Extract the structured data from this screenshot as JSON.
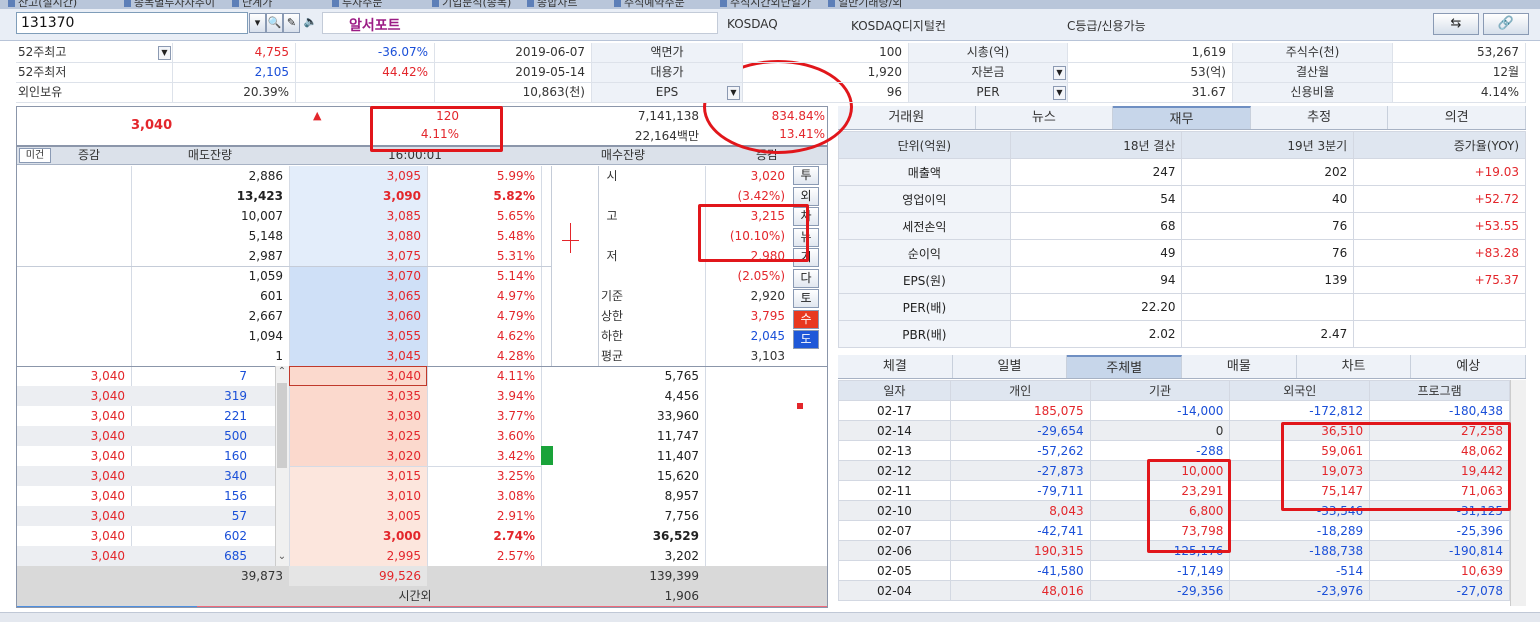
{
  "top_tabs": [
    "잔고(실시간)",
    "종목별투자자추이",
    "단계가",
    "투자주문",
    "기업분석(종목)",
    "종합차트",
    "주식예약주문",
    "주식시간외단일가",
    "일반기래량/외"
  ],
  "header": {
    "code": "131370",
    "name": "알서포트",
    "market": "KOSDAQ",
    "sector": "KOSDAQ디지털컨",
    "credit": "C등급/신용가능"
  },
  "info": {
    "rows": [
      {
        "l1": "52주최고",
        "v1": "4,755",
        "p1": "-36.07%",
        "d1": "2019-06-07",
        "l2": "액면가",
        "v2": "100",
        "l3": "시총(억)",
        "v3": "1,619",
        "l4": "주식수(천)",
        "v4": "53,267"
      },
      {
        "l1": "52주최저",
        "v1": "2,105",
        "p1": "44.42%",
        "d1": "2019-05-14",
        "l2": "대용가",
        "v2": "1,920",
        "l3": "자본금",
        "v3": "53(억)",
        "l4": "결산월",
        "v4": "12월"
      },
      {
        "l1": "외인보유",
        "v1": "20.39%",
        "p1": "",
        "d1": "10,863(천)",
        "l2": "EPS",
        "v2": "96",
        "l3": "PER",
        "v3": "31.67",
        "l4": "신용비율",
        "v4": "4.14%"
      }
    ]
  },
  "summary": {
    "price": "3,040",
    "arrow": "▲",
    "change": "120",
    "change_pct": "4.11%",
    "volume": "7,141,138",
    "amount": "22,164백만",
    "ratio1": "834.84%",
    "ratio2": "13.41%"
  },
  "orderbook": {
    "headers": {
      "btn": "미건",
      "chg": "증감",
      "sell": "매도잔량",
      "time": "16:00:01",
      "buy": "매수잔량",
      "chg2": "증감"
    },
    "ask_rows": [
      {
        "qty": "2,886",
        "price": "3,095",
        "pct": "5.99%"
      },
      {
        "qty": "13,423",
        "price": "3,090",
        "pct": "5.82%",
        "bold": true
      },
      {
        "qty": "10,007",
        "price": "3,085",
        "pct": "5.65%"
      },
      {
        "qty": "5,148",
        "price": "3,080",
        "pct": "5.48%"
      },
      {
        "qty": "2,987",
        "price": "3,075",
        "pct": "5.31%"
      },
      {
        "qty": "1,059",
        "price": "3,070",
        "pct": "5.14%"
      },
      {
        "qty": "601",
        "price": "3,065",
        "pct": "4.97%"
      },
      {
        "qty": "2,667",
        "price": "3,060",
        "pct": "4.79%"
      },
      {
        "qty": "1,094",
        "price": "3,055",
        "pct": "4.62%"
      },
      {
        "qty": "1",
        "price": "3,045",
        "pct": "4.28%"
      }
    ],
    "stats": [
      {
        "label": "시",
        "value": "3,020"
      },
      {
        "label": "",
        "value": "(3.42%)"
      },
      {
        "label": "고",
        "value": "3,215"
      },
      {
        "label": "",
        "value": "(10.10%)"
      },
      {
        "label": "저",
        "value": "2,980"
      },
      {
        "label": "",
        "value": "(2.05%)"
      },
      {
        "label": "기준",
        "value": "2,920"
      },
      {
        "label": "상한",
        "value": "3,795"
      },
      {
        "label": "하한",
        "value": "2,045"
      },
      {
        "label": "평균",
        "value": "3,103"
      }
    ],
    "side_buttons": [
      "투",
      "외",
      "차",
      "뉴",
      "기",
      "다",
      "토",
      "수",
      "도"
    ],
    "trades": [
      {
        "price": "3,040",
        "qty": "7"
      },
      {
        "price": "3,040",
        "qty": "319"
      },
      {
        "price": "3,040",
        "qty": "221"
      },
      {
        "price": "3,040",
        "qty": "500"
      },
      {
        "price": "3,040",
        "qty": "160"
      },
      {
        "price": "3,040",
        "qty": "340"
      },
      {
        "price": "3,040",
        "qty": "156"
      },
      {
        "price": "3,040",
        "qty": "57"
      },
      {
        "price": "3,040",
        "qty": "602"
      },
      {
        "price": "3,040",
        "qty": "685"
      }
    ],
    "bid_rows": [
      {
        "price": "3,040",
        "pct": "4.11%",
        "qty": "5,765"
      },
      {
        "price": "3,035",
        "pct": "3.94%",
        "qty": "4,456"
      },
      {
        "price": "3,030",
        "pct": "3.77%",
        "qty": "33,960"
      },
      {
        "price": "3,025",
        "pct": "3.60%",
        "qty": "11,747"
      },
      {
        "price": "3,020",
        "pct": "3.42%",
        "qty": "11,407"
      },
      {
        "price": "3,015",
        "pct": "3.25%",
        "qty": "15,620"
      },
      {
        "price": "3,010",
        "pct": "3.08%",
        "qty": "8,957"
      },
      {
        "price": "3,005",
        "pct": "2.91%",
        "qty": "7,756"
      },
      {
        "price": "3,000",
        "pct": "2.74%",
        "qty": "36,529",
        "bold": true
      },
      {
        "price": "2,995",
        "pct": "2.57%",
        "qty": "3,202"
      }
    ],
    "totals": {
      "sell": "39,873",
      "diff": "99,526",
      "buy": "139,399"
    },
    "after_hours": {
      "label": "시간외",
      "value": "1,906"
    }
  },
  "fin_tabs": [
    "거래원",
    "뉴스",
    "재무",
    "추정",
    "의견"
  ],
  "fin": {
    "headers": [
      "단위(억원)",
      "18년 결산",
      "19년 3분기",
      "증가율(YOY)"
    ],
    "rows": [
      [
        "매출액",
        "247",
        "202",
        "+19.03"
      ],
      [
        "영업이익",
        "54",
        "40",
        "+52.72"
      ],
      [
        "세전손익",
        "68",
        "76",
        "+53.55"
      ],
      [
        "순이익",
        "49",
        "76",
        "+83.28"
      ],
      [
        "EPS(원)",
        "94",
        "139",
        "+75.37"
      ],
      [
        "PER(배)",
        "22.20",
        "",
        ""
      ],
      [
        "PBR(배)",
        "2.02",
        "2.47",
        ""
      ]
    ]
  },
  "inv_tabs": [
    "체결",
    "일별",
    "주체별",
    "매물",
    "차트",
    "예상"
  ],
  "inv": {
    "headers": [
      "일자",
      "개인",
      "기관",
      "외국인",
      "프로그램"
    ],
    "rows": [
      [
        "02-17",
        "185,075",
        "-14,000",
        "-172,812",
        "-180,438"
      ],
      [
        "02-14",
        "-29,654",
        "0",
        "36,510",
        "27,258"
      ],
      [
        "02-13",
        "-57,262",
        "-288",
        "59,061",
        "48,062"
      ],
      [
        "02-12",
        "-27,873",
        "10,000",
        "19,073",
        "19,442"
      ],
      [
        "02-11",
        "-79,711",
        "23,291",
        "75,147",
        "71,063"
      ],
      [
        "02-10",
        "8,043",
        "6,800",
        "-33,546",
        "-31,125"
      ],
      [
        "02-07",
        "-42,741",
        "73,798",
        "-18,289",
        "-25,396"
      ],
      [
        "02-06",
        "190,315",
        "-125,176",
        "-188,738",
        "-190,814"
      ],
      [
        "02-05",
        "-41,580",
        "-17,149",
        "-514",
        "10,639"
      ],
      [
        "02-04",
        "48,016",
        "-29,356",
        "-23,976",
        "-27,078"
      ]
    ]
  },
  "colors": {
    "up": "#e3262b",
    "down": "#1a4fd8",
    "highlight": "#e1161b"
  }
}
